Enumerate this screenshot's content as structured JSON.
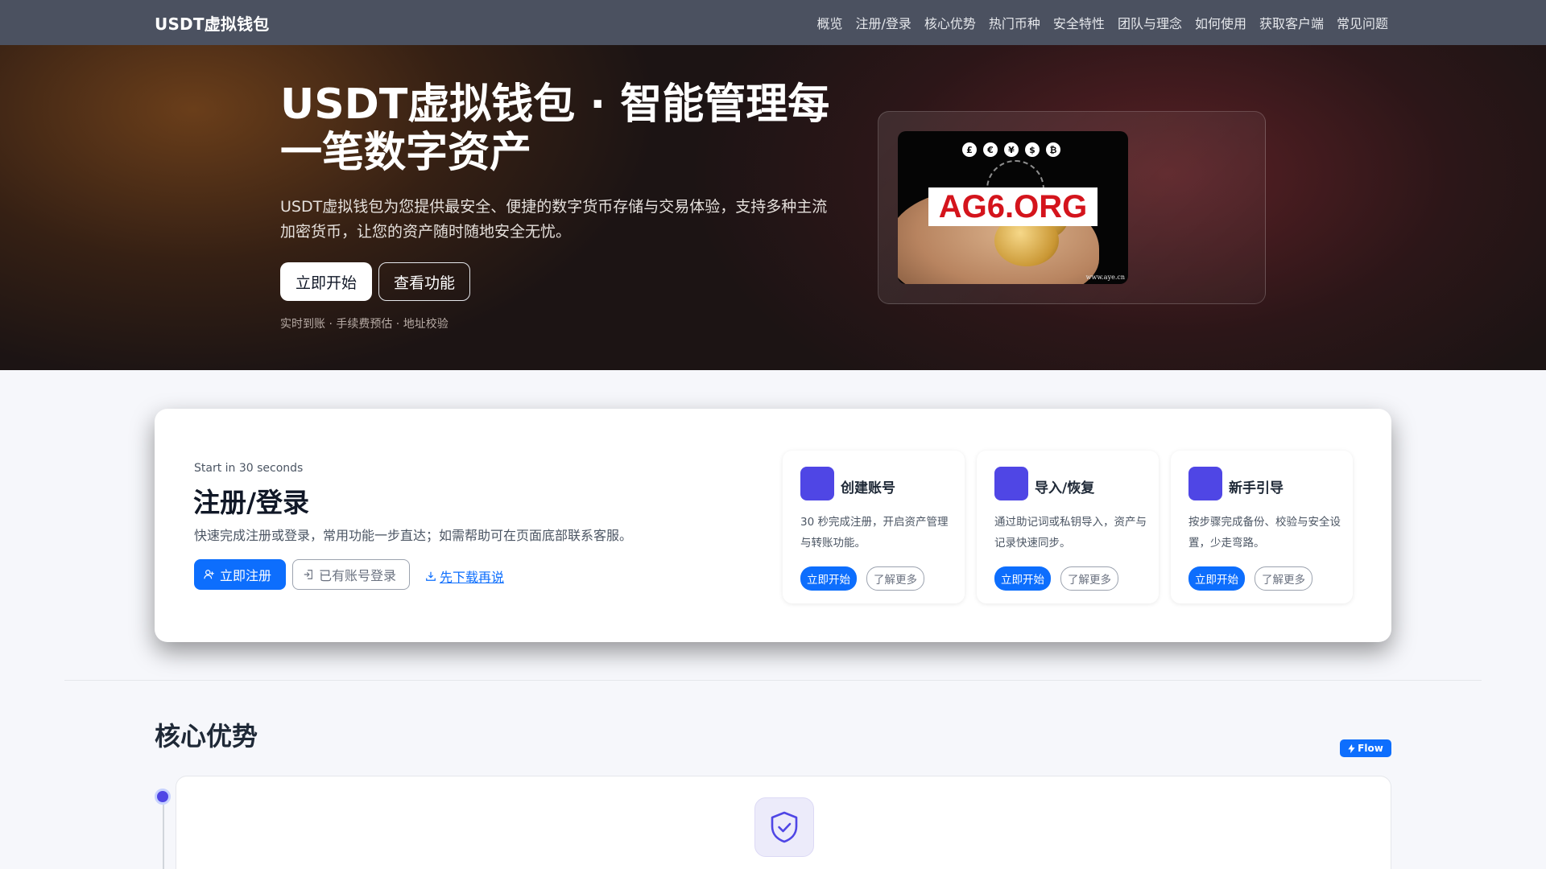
{
  "nav": {
    "brand": "USDT虚拟钱包",
    "links": [
      "概览",
      "注册/登录",
      "核心优势",
      "热门币种",
      "安全特性",
      "团队与理念",
      "如何使用",
      "获取客户端",
      "常见问题"
    ]
  },
  "hero": {
    "title": "USDT虚拟钱包 · 智能管理每一笔数字资产",
    "description": "USDT虚拟钱包为您提供最安全、便捷的数字货币存储与交易体验，支持多种主流加密货币，让您的资产随时随地安全无忧。",
    "start_label": "立即开始",
    "features_label": "查看功能",
    "tags": "实时到账 · 手续费预估 · 地址校验",
    "image": {
      "coins": [
        "£",
        "€",
        "¥",
        "$",
        "₿"
      ],
      "banner_text": "AG6.ORG",
      "watermark": "www.aye.cn"
    }
  },
  "register": {
    "kicker": "Start in 30 seconds",
    "title": "注册/登录",
    "description": "快速完成注册或登录，常用功能一步直达；如需帮助可在页面底部联系客服。",
    "register_label": "立即注册",
    "login_label": "已有账号登录",
    "download_label": "先下载再说",
    "cards": [
      {
        "title": "创建账号",
        "description": "30 秒完成注册，开启资产管理与转账功能。",
        "start": "立即开始",
        "more": "了解更多"
      },
      {
        "title": "导入/恢复",
        "description": "通过助记词或私钥导入，资产与记录快速同步。",
        "start": "立即开始",
        "more": "了解更多"
      },
      {
        "title": "新手引导",
        "description": "按步骤完成备份、校验与安全设置，少走弯路。",
        "start": "立即开始",
        "more": "了解更多"
      }
    ]
  },
  "core": {
    "title": "核心优势",
    "flow_badge": "Flow"
  },
  "colors": {
    "primary": "#0d6efd",
    "accent": "#4f46e5",
    "nav_bg": "#4b5160"
  }
}
